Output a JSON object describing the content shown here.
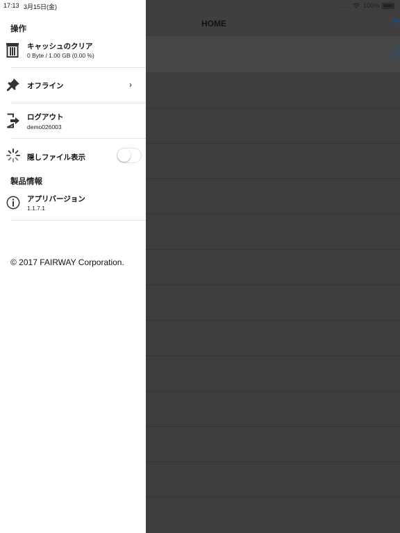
{
  "status": {
    "time": "17:13",
    "date": "3月15日(金)",
    "battery": "100%"
  },
  "main": {
    "title": "HOME"
  },
  "drawer": {
    "section_operation": "操作",
    "cache": {
      "title": "キャッシュのクリア",
      "subtitle": "0 Byte / 1.00 GB (0.00 %)"
    },
    "offline": {
      "title": "オフライン"
    },
    "logout": {
      "title": "ログアウト",
      "subtitle": "demo026003"
    },
    "hidden_files": {
      "title": "隠しファイル表示",
      "enabled": false
    },
    "section_product": "製品情報",
    "version": {
      "title": "アプリバージョン",
      "subtitle": "1.1.7.1"
    },
    "copyright": "© 2017 FAIRWAY Corporation."
  }
}
